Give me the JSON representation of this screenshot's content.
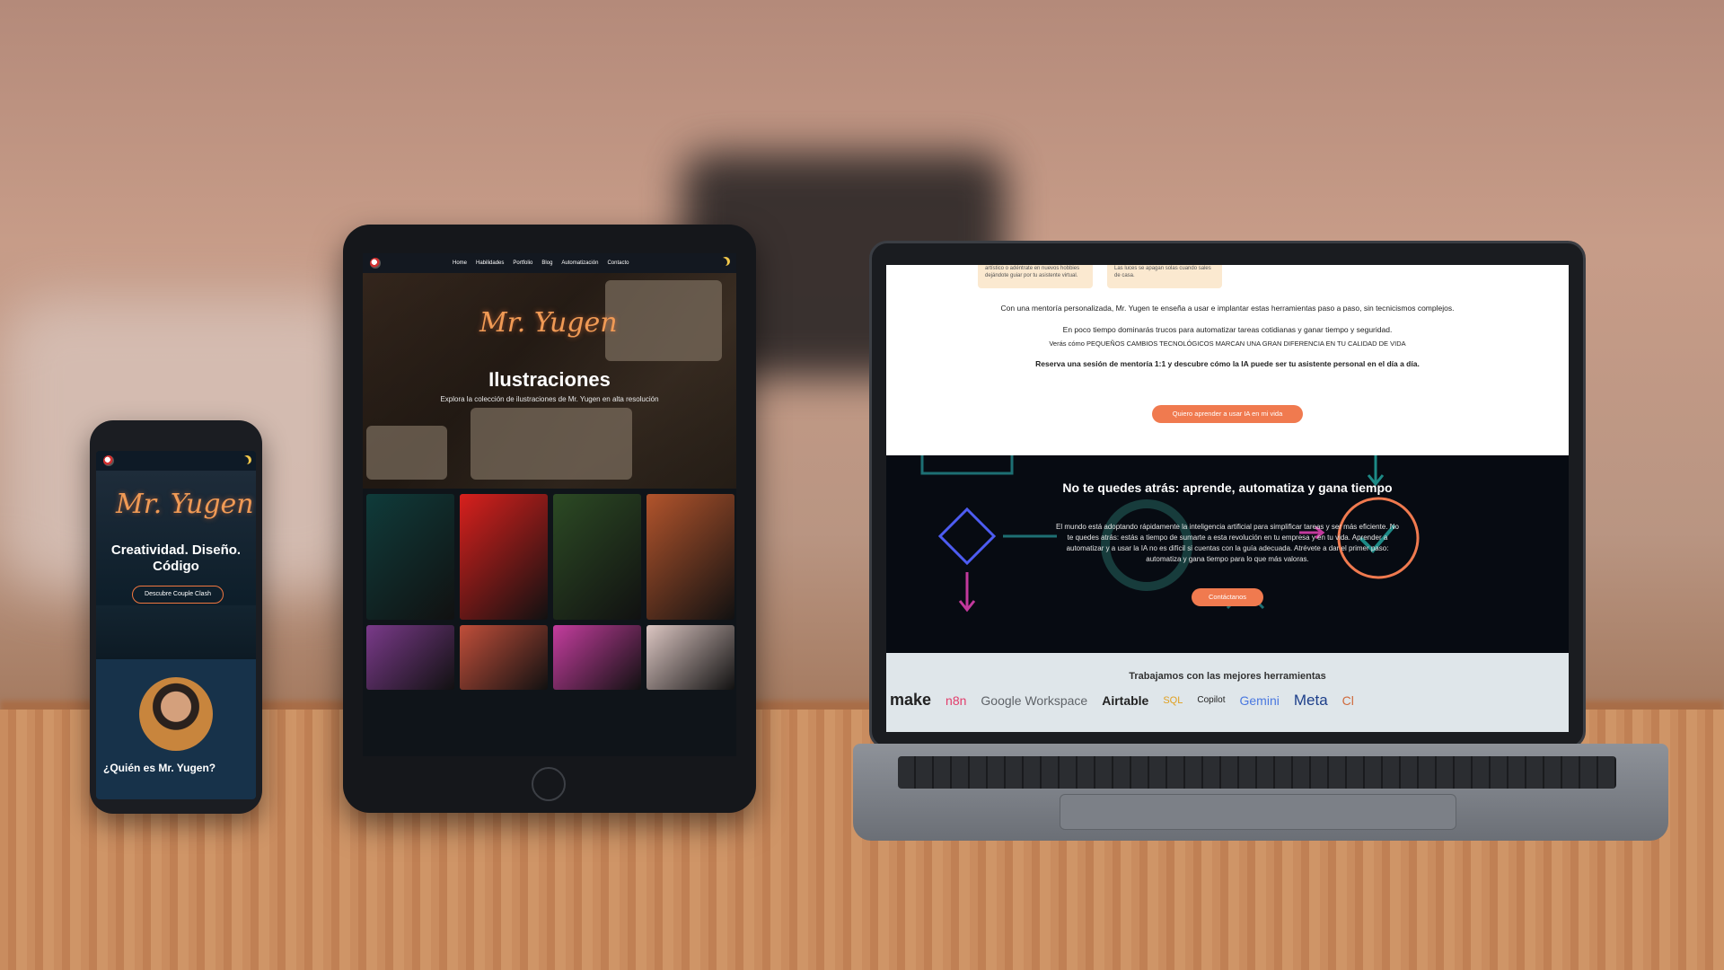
{
  "phone": {
    "brand": "Mr. Yugen",
    "headline": "Creatividad. Diseño. Código",
    "cta": "Descubre Couple Clash",
    "about_title": "¿Quién es Mr. Yugen?"
  },
  "tablet": {
    "nav": [
      "Home",
      "Habilidades",
      "Portfolio",
      "Blog",
      "Automatización",
      "Contacto"
    ],
    "brand": "Mr. Yugen",
    "title": "Ilustraciones",
    "subtitle": "Explora la colección de ilustraciones de Mr. Yugen en alta resolución",
    "gallery_colors": [
      "#0f3b3a",
      "#d8201d",
      "#2c4a24",
      "#b2542c",
      "#7a3a8a",
      "#c04e3a",
      "#c43d9e",
      "#dcc6c2"
    ]
  },
  "laptop": {
    "card_left": "artístico o adéntrate en nuevos hobbies dejándote guiar por tu asistente virtual.",
    "card_right": "Las luces se apagan solas cuando sales de casa.",
    "intro": "Con una mentoría personalizada, Mr. Yugen te enseña a usar e implantar estas herramientas paso a paso, sin tecnicismos complejos.",
    "tricks": "En poco tiempo dominarás trucos para automatizar tareas cotidianas y ganar tiempo y seguridad.",
    "changes": "Verás cómo PEQUEÑOS CAMBIOS TECNOLÓGICOS MARCAN UNA GRAN DIFERENCIA EN TU CALIDAD DE VIDA",
    "booking": "Reserva una sesión de mentoría 1:1 y descubre cómo la IA puede ser tu asistente personal en el día a día.",
    "cta": "Quiero aprender a usar IA en mi vida",
    "section_title": "No te quedes atrás: aprende, automatiza y gana tiempo",
    "section_text": "El mundo está adoptando rápidamente la inteligencia artificial para simplificar tareas y ser más eficiente. No te quedes atrás: estás a tiempo de sumarte a esta revolución en tu empresa y en tu vida. Aprender a automatizar y a usar la IA no es difícil si cuentas con la guía adecuada. Atrévete a dar el primer paso: automatiza y gana tiempo para lo que más valoras.",
    "contact_cta": "Contáctanos",
    "tools_title": "Trabajamos con las mejores herramientas",
    "tools": [
      "make",
      "n8n",
      "Google Workspace",
      "Airtable",
      "SQL",
      "Copilot",
      "Gemini",
      "Meta",
      "Cl"
    ],
    "accent_color": "#f07a4f"
  }
}
